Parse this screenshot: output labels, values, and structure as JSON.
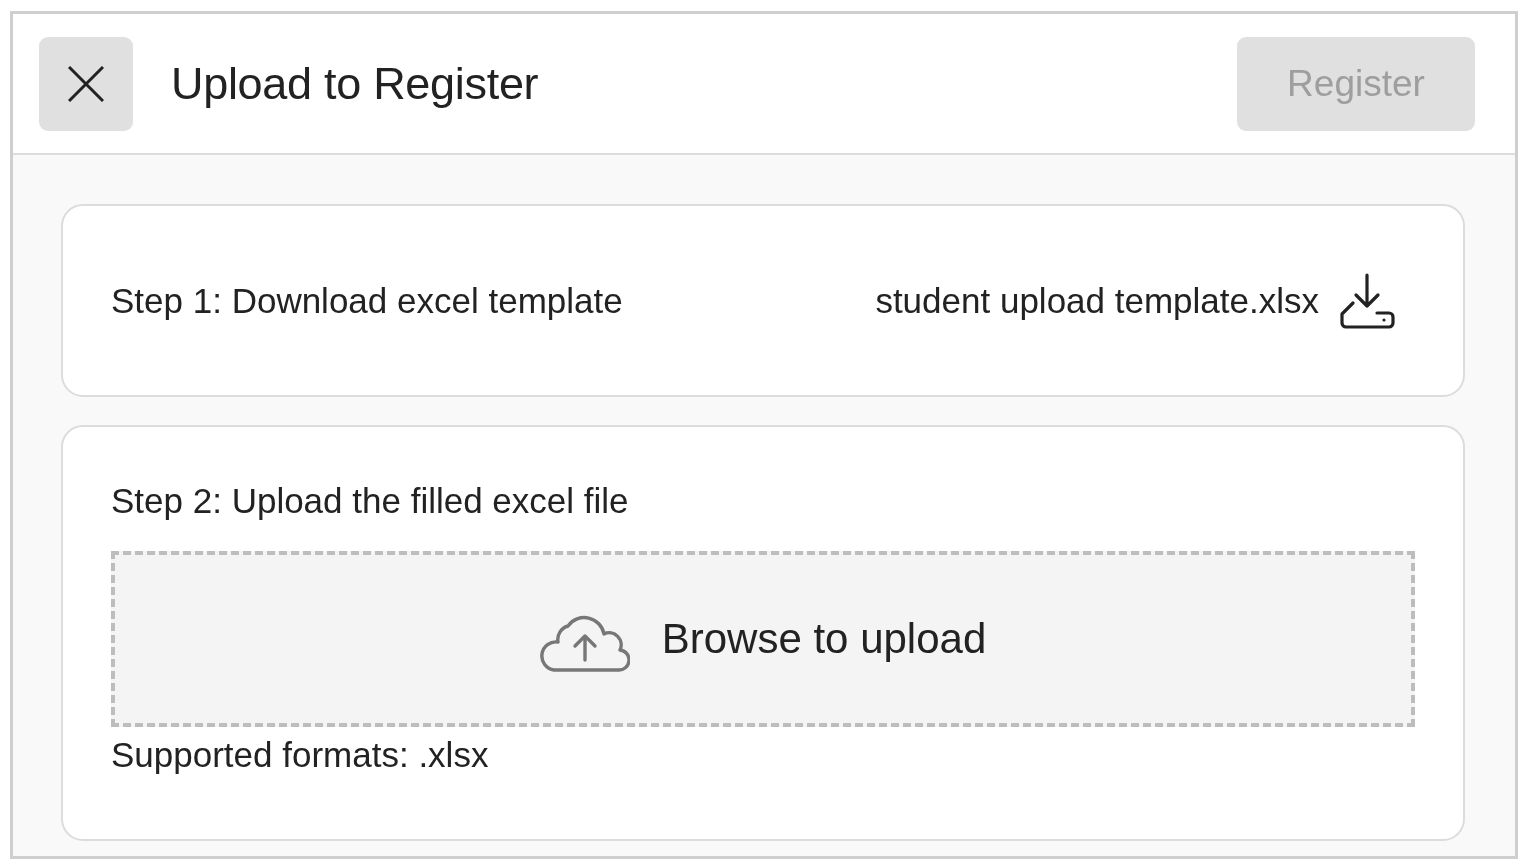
{
  "header": {
    "title": "Upload to Register",
    "register_button": {
      "label": "Register",
      "disabled": true
    }
  },
  "steps": [
    {
      "kind": "download",
      "label": "Step 1: Download excel template",
      "file_name": "student upload template.xlsx"
    },
    {
      "kind": "upload",
      "label": "Step 2: Upload the filled excel file",
      "dropzone": {
        "label": "Browse to upload"
      },
      "note": "Supported formats: .xlsx"
    }
  ]
}
